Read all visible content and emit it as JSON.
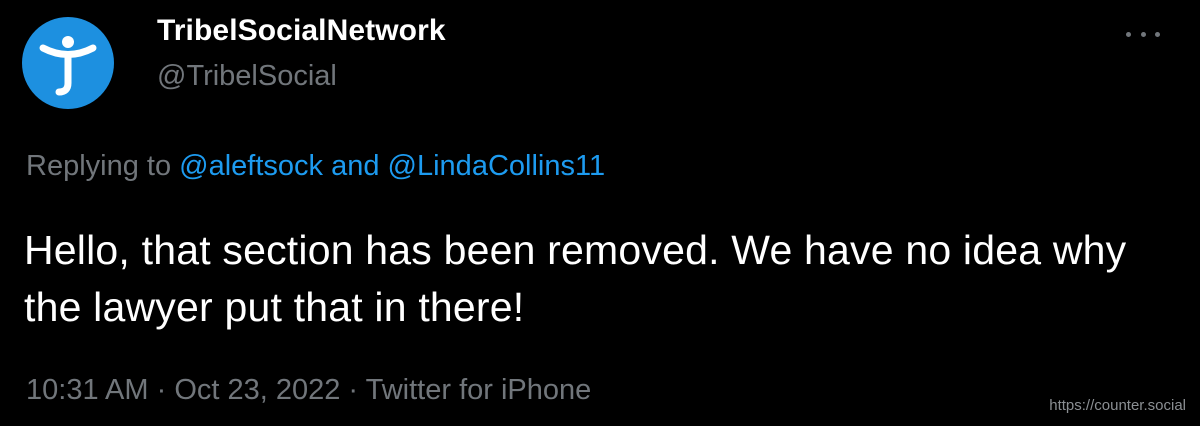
{
  "account": {
    "display_name": "TribelSocialNetwork",
    "handle": "@TribelSocial",
    "avatar_icon": "tribel-logo-icon",
    "avatar_color": "#1d90e0"
  },
  "more_menu": {
    "icon": "more-options-icon"
  },
  "reply_context": {
    "prefix": "Replying to ",
    "mention_1": "@aleftsock",
    "joiner": " and ",
    "mention_2": "@LindaCollins11"
  },
  "tweet": {
    "text": "Hello, that section has been removed. We have no idea why the lawyer put that in there!"
  },
  "meta": {
    "time": "10:31 AM",
    "separator_1": " · ",
    "date": "Oct 23, 2022",
    "separator_2": " · ",
    "source": "Twitter for iPhone"
  },
  "watermark": "https://counter.social",
  "colors": {
    "background": "#000000",
    "primary_text": "#ffffff",
    "secondary_text": "#71767b",
    "link": "#1d9bf0"
  }
}
